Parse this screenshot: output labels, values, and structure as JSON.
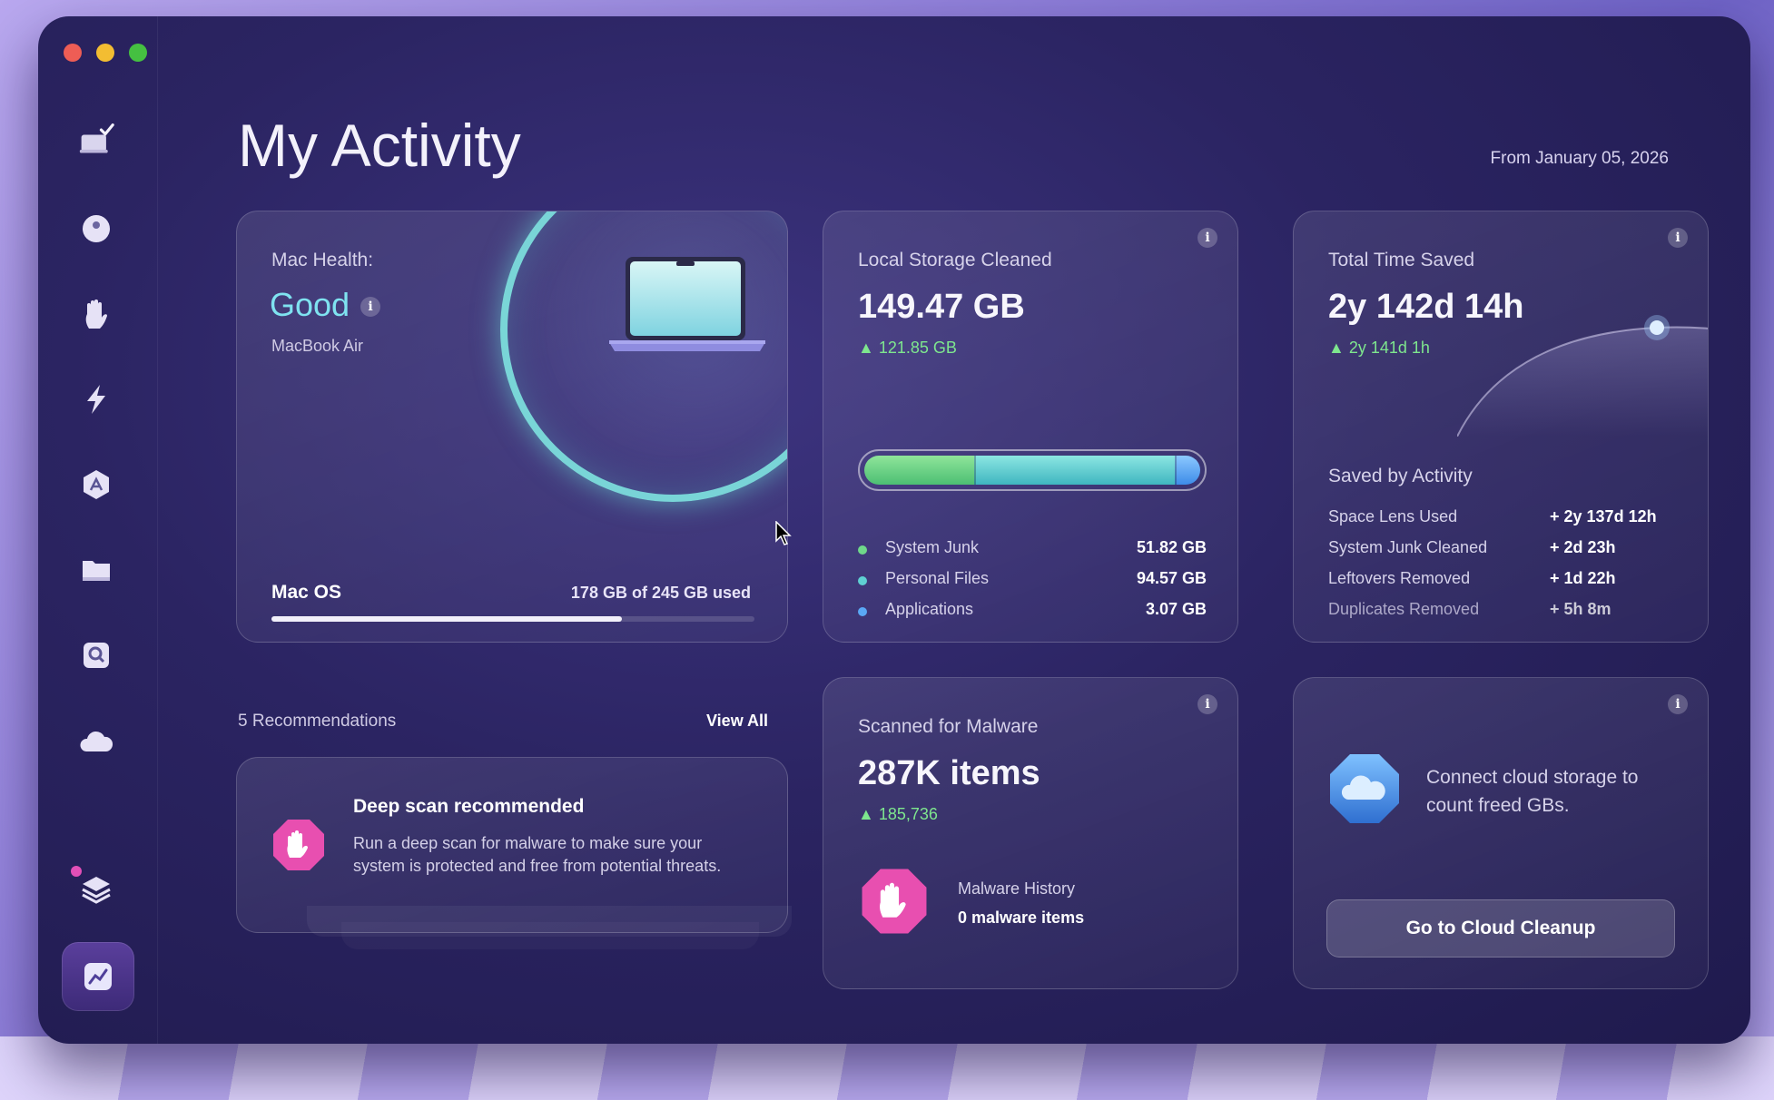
{
  "window": {
    "controls": [
      "close",
      "minimize",
      "zoom"
    ]
  },
  "sidebar": {
    "items": [
      {
        "icon": "smart-care-icon"
      },
      {
        "icon": "cleanup-icon"
      },
      {
        "icon": "protection-hand-icon"
      },
      {
        "icon": "performance-bolt-icon"
      },
      {
        "icon": "applications-icon"
      },
      {
        "icon": "my-clutter-folder-icon"
      },
      {
        "icon": "space-lens-icon"
      },
      {
        "icon": "cloud-icon"
      },
      {
        "icon": "assistant-layers-icon"
      },
      {
        "icon": "my-activity-chart-icon",
        "active": true
      }
    ]
  },
  "header": {
    "title": "My Activity",
    "date_range": "From January 05, 2026"
  },
  "mac_health": {
    "label": "Mac Health:",
    "status": "Good",
    "model": "MacBook Air",
    "os_label": "Mac OS",
    "usage_text": "178 GB of 245 GB used",
    "used_fraction": 0.7265
  },
  "recommendations": {
    "count_label": "5 Recommendations",
    "view_all": "View All",
    "items": [
      {
        "title": "Deep scan recommended",
        "description": "Run a deep scan for malware to make sure your system is protected and free from potential threats."
      }
    ]
  },
  "storage": {
    "label": "Local Storage Cleaned",
    "value": "149.47 GB",
    "delta": "▲ 121.85 GB",
    "breakdown": [
      {
        "name": "System Junk",
        "value": "51.82 GB",
        "gb": 51.82,
        "color": "#6fd88a"
      },
      {
        "name": "Personal Files",
        "value": "94.57 GB",
        "gb": 94.57,
        "color": "#5fd0d2"
      },
      {
        "name": "Applications",
        "value": "3.07 GB",
        "gb": 3.07,
        "color": "#5aa8f5"
      }
    ]
  },
  "time_saved": {
    "label": "Total Time Saved",
    "value": "2y 142d 14h",
    "delta": "▲ 2y 141d 1h",
    "activity_title": "Saved by Activity",
    "activities": [
      {
        "name": "Space Lens Used",
        "value": "+ 2y 137d 12h"
      },
      {
        "name": "System Junk Cleaned",
        "value": "+ 2d 23h"
      },
      {
        "name": "Leftovers Removed",
        "value": "+ 1d 22h"
      },
      {
        "name": "Duplicates Removed",
        "value": "+ 5h 8m"
      }
    ]
  },
  "malware": {
    "label": "Scanned for Malware",
    "value": "287K items",
    "delta": "▲ 185,736",
    "history_label": "Malware History",
    "history_value": "0 malware items"
  },
  "cloud": {
    "text": "Connect cloud storage to count freed GBs.",
    "button": "Go to Cloud Cleanup"
  },
  "colors": {
    "accent_good": "#7fe3f0",
    "delta_green": "#7ee68e",
    "malware_pink": "#e84fb0"
  }
}
